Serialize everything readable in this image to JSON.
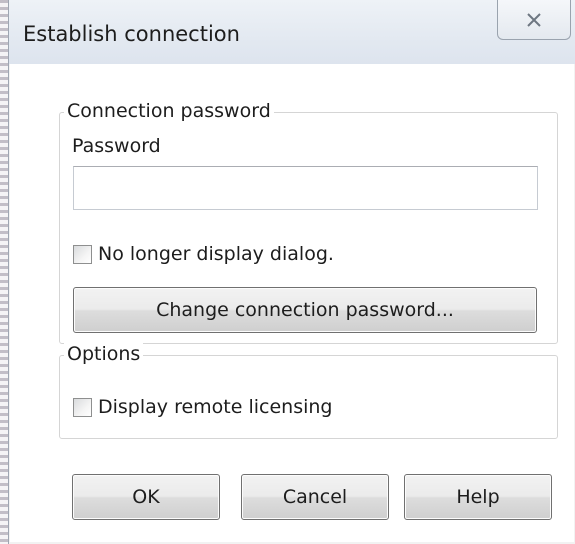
{
  "window": {
    "title": "Establish connection",
    "close_icon": "close-icon"
  },
  "connection_group": {
    "legend": "Connection password",
    "password_label": "Password",
    "password_value": "",
    "password_placeholder": "",
    "no_longer_display": {
      "label": "No longer display dialog.",
      "checked": false
    },
    "change_button_label": "Change connection password..."
  },
  "options_group": {
    "legend": "Options",
    "display_remote_licensing": {
      "label": "Display remote licensing",
      "checked": false
    }
  },
  "buttons": {
    "ok_label": "OK",
    "cancel_label": "Cancel",
    "help_label": "Help"
  }
}
